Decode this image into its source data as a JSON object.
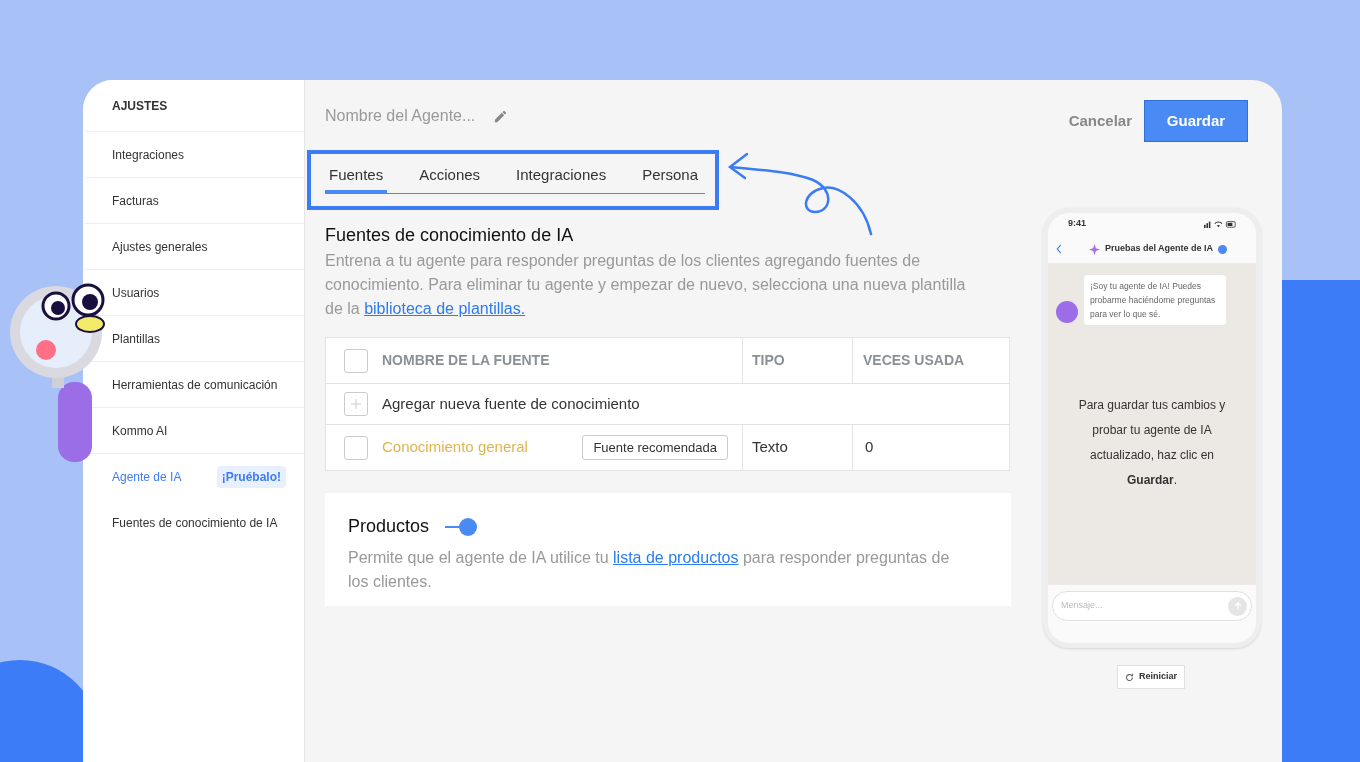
{
  "sidebar": {
    "title": "AJUSTES",
    "items": [
      {
        "label": "Integraciones",
        "selected": false
      },
      {
        "label": "Facturas",
        "selected": false
      },
      {
        "label": "Ajustes generales",
        "selected": false
      },
      {
        "label": "Usuarios",
        "selected": false
      },
      {
        "label": "Plantillas",
        "selected": false
      },
      {
        "label": "Herramientas de comunicación",
        "selected": false
      },
      {
        "label": "Kommo AI",
        "selected": false
      },
      {
        "label": "Agente de IA",
        "selected": true,
        "badge": "¡Pruébalo!"
      },
      {
        "label": "Fuentes de conocimiento de IA",
        "selected": false
      }
    ]
  },
  "agent_name": {
    "placeholder": "Nombre del Agente..."
  },
  "actions": {
    "cancel": "Cancelar",
    "save": "Guardar"
  },
  "tabs": [
    {
      "label": "Fuentes",
      "selected": true
    },
    {
      "label": "Acciones",
      "selected": false
    },
    {
      "label": "Integraciones",
      "selected": false
    },
    {
      "label": "Persona",
      "selected": false
    }
  ],
  "section": {
    "title": "Fuentes de conocimiento de IA",
    "description": "Entrena a tu agente para responder preguntas de los clientes agregando fuentes de conocimiento. Para eliminar tu agente y empezar de nuevo, selecciona una nueva plantilla de la ",
    "link": "biblioteca de plantillas."
  },
  "table": {
    "select_all_checked": false,
    "columns": [
      "NOMBRE DE LA FUENTE",
      "TIPO",
      "VECES USADA"
    ],
    "add_row": "Agregar nueva fuente de conocimiento",
    "rows": [
      {
        "name": "Conocimiento general",
        "tag": "Fuente recomendada",
        "type": "Texto",
        "uses": "0",
        "checked": false
      }
    ]
  },
  "products": {
    "title": "Productos",
    "on": true,
    "text_before": "Permite que el agente de IA utilice tu ",
    "link": "lista de productos",
    "text_after": " para responder preguntas de los clientes."
  },
  "phone": {
    "time": "9:41",
    "chat_title": "Pruebas del Agente de IA",
    "verified": true,
    "bot_message": "¡Soy tu agente de IA! Puedes probarme haciéndome preguntas para ver lo que sé.",
    "notice": "Para guardar tus cambios y probar tu agente de IA actualizado, haz clic en **Guardar**.",
    "input_placeholder": "Mensaje..."
  },
  "reset_button": "Reiniciar"
}
